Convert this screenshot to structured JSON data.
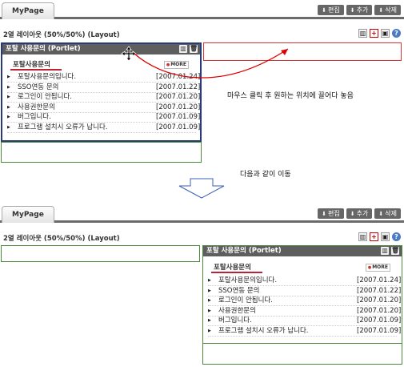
{
  "tab": {
    "label": "MyPage"
  },
  "toolbar": {
    "edit": "편집",
    "add": "추가",
    "delete": "삭제"
  },
  "layout": {
    "title": "2열 레이아웃 (50%/50%) (Layout)"
  },
  "portlet": {
    "title": "포탈 사용문의 (Portlet)",
    "subtitle": "포탈사용문의",
    "more": "MORE",
    "items": [
      {
        "title": "포탈사용문의입니다.",
        "date": "[2007.01.24]"
      },
      {
        "title": "SSO연동 문의",
        "date": "[2007.01.22]"
      },
      {
        "title": "로그인이 안됩니다.",
        "date": "[2007.01.20]"
      },
      {
        "title": "사용권한문의",
        "date": "[2007.01.20]"
      },
      {
        "title": "버그입니다.",
        "date": "[2007.01.09]"
      },
      {
        "title": "프로그램 설치시 오류가 납니다.",
        "date": "[2007.01.09]"
      }
    ]
  },
  "notes": {
    "drag": "마우스 클릭 후 원하는 위치에 끌어다 놓음",
    "move": "다음과 같이 이동"
  }
}
